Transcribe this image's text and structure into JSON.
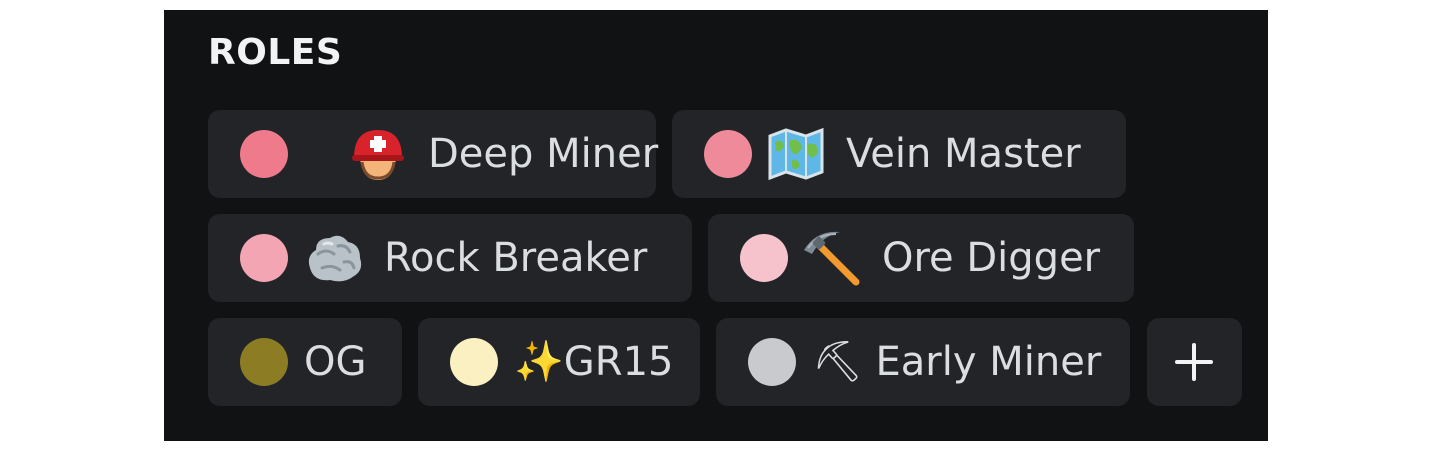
{
  "section": {
    "title": "ROLES"
  },
  "roles": [
    {
      "name": "Deep Miner",
      "color": "#ef7a8c",
      "icon": "rescue-helmet-icon"
    },
    {
      "name": "Vein Master",
      "color": "#ef8a9a",
      "icon": "world-map-icon"
    },
    {
      "name": "Rock Breaker",
      "color": "#f3a5b3",
      "icon": "rock-icon"
    },
    {
      "name": "Ore Digger",
      "color": "#f6c3cc",
      "icon": "pick-icon"
    },
    {
      "name": "OG",
      "color": "#8c7d25",
      "icon": ""
    },
    {
      "name": "✨GR15",
      "color": "#faf0c2",
      "icon": ""
    },
    {
      "name": "⛏ Early Miner",
      "color": "#c8cacd",
      "icon": ""
    }
  ],
  "add_button": {
    "icon": "plus-icon"
  },
  "colors": {
    "panel_background": "#111214",
    "pill_background": "#232428",
    "text": "#dbdee1"
  }
}
